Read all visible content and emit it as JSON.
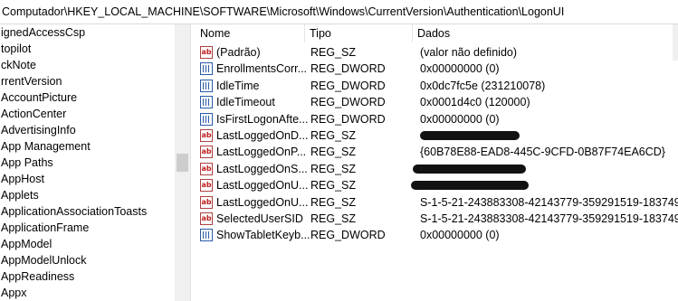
{
  "address": "Computador\\HKEY_LOCAL_MACHINE\\SOFTWARE\\Microsoft\\Windows\\CurrentVersion\\Authentication\\LogonUI",
  "tree": {
    "items": [
      "ignedAccessCsp",
      "topilot",
      "ckNote",
      "rrentVersion",
      "AccountPicture",
      "ActionCenter",
      "AdvertisingInfo",
      "App Management",
      "App Paths",
      "AppHost",
      "Applets",
      "ApplicationAssociationToasts",
      "ApplicationFrame",
      "AppModel",
      "AppModelUnlock",
      "AppReadiness",
      "Appx"
    ]
  },
  "list": {
    "headers": {
      "name": "Nome",
      "type": "Tipo",
      "data": "Dados"
    },
    "rows": [
      {
        "icon": "string-value-icon",
        "name": "(Padrão)",
        "type": "REG_SZ",
        "data": "(valor não definido)"
      },
      {
        "icon": "binary-value-icon",
        "name": "EnrollmentsCorr...",
        "type": "REG_DWORD",
        "data": "0x00000000 (0)"
      },
      {
        "icon": "binary-value-icon",
        "name": "IdleTime",
        "type": "REG_DWORD",
        "data": "0x0dc7fc5e (231210078)"
      },
      {
        "icon": "binary-value-icon",
        "name": "IdleTimeout",
        "type": "REG_DWORD",
        "data": "0x0001d4c0 (120000)"
      },
      {
        "icon": "binary-value-icon",
        "name": "IsFirstLogonAfte...",
        "type": "REG_DWORD",
        "data": "0x00000000 (0)"
      },
      {
        "icon": "string-value-icon",
        "name": "LastLoggedOnD...",
        "type": "REG_SZ",
        "data": ""
      },
      {
        "icon": "string-value-icon",
        "name": "LastLoggedOnP...",
        "type": "REG_SZ",
        "data": "{60B78E88-EAD8-445C-9CFD-0B87F74EA6CD}"
      },
      {
        "icon": "string-value-icon",
        "name": "LastLoggedOnS...",
        "type": "REG_SZ",
        "data": ""
      },
      {
        "icon": "string-value-icon",
        "name": "LastLoggedOnU...",
        "type": "REG_SZ",
        "data": ""
      },
      {
        "icon": "string-value-icon",
        "name": "LastLoggedOnU...",
        "type": "REG_SZ",
        "data": "S-1-5-21-243883308-42143779-359291519-183749"
      },
      {
        "icon": "string-value-icon",
        "name": "SelectedUserSID",
        "type": "REG_SZ",
        "data": "S-1-5-21-243883308-42143779-359291519-183749"
      },
      {
        "icon": "binary-value-icon",
        "name": "ShowTabletKeyb...",
        "type": "REG_DWORD",
        "data": "0x00000000 (0)"
      }
    ]
  }
}
